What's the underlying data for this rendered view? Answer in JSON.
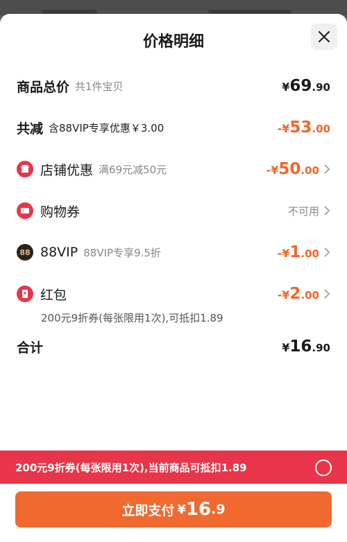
{
  "title": "价格明细",
  "rows": {
    "total": {
      "label": "商品总价",
      "sub": "共1件宝贝",
      "symbol": "¥",
      "int": "69",
      "dec": ".90"
    },
    "reduce": {
      "label": "共减",
      "sub": "含88VIP专享优惠￥3.00",
      "symbol": "-¥",
      "int": "53",
      "dec": ".00"
    },
    "shop": {
      "label": "店铺优惠",
      "sub": "满69元减50元",
      "symbol": "-¥",
      "int": "50",
      "dec": ".00",
      "icon": "shop-icon"
    },
    "coupon": {
      "label": "购物券",
      "status": "不可用",
      "icon": "coupon-icon"
    },
    "vip": {
      "label": "88VIP",
      "sub": "88VIP专享9.5折",
      "symbol": "-¥",
      "int": "1",
      "dec": ".00",
      "icon": "88vip-icon",
      "icon_text": "88"
    },
    "hongbao": {
      "label": "红包",
      "note": "200元9折券(每张限用1次),可抵扣1.89",
      "symbol": "-¥",
      "int": "2",
      "dec": ".00",
      "icon": "red-packet-icon"
    },
    "sum": {
      "label": "合计",
      "symbol": "¥",
      "int": "16",
      "dec": ".90"
    }
  },
  "banner": {
    "text": "200元9折券(每张限用1次),当前商品可抵扣1.89"
  },
  "pay": {
    "label": "立即支付",
    "symbol": "¥",
    "int": "16",
    "dec": ".9"
  },
  "colors": {
    "accent": "#f06a30",
    "discount": "#f0662b",
    "banner": "#e8354a",
    "icon_red": "#e8354a",
    "vip": "#2a221d"
  }
}
